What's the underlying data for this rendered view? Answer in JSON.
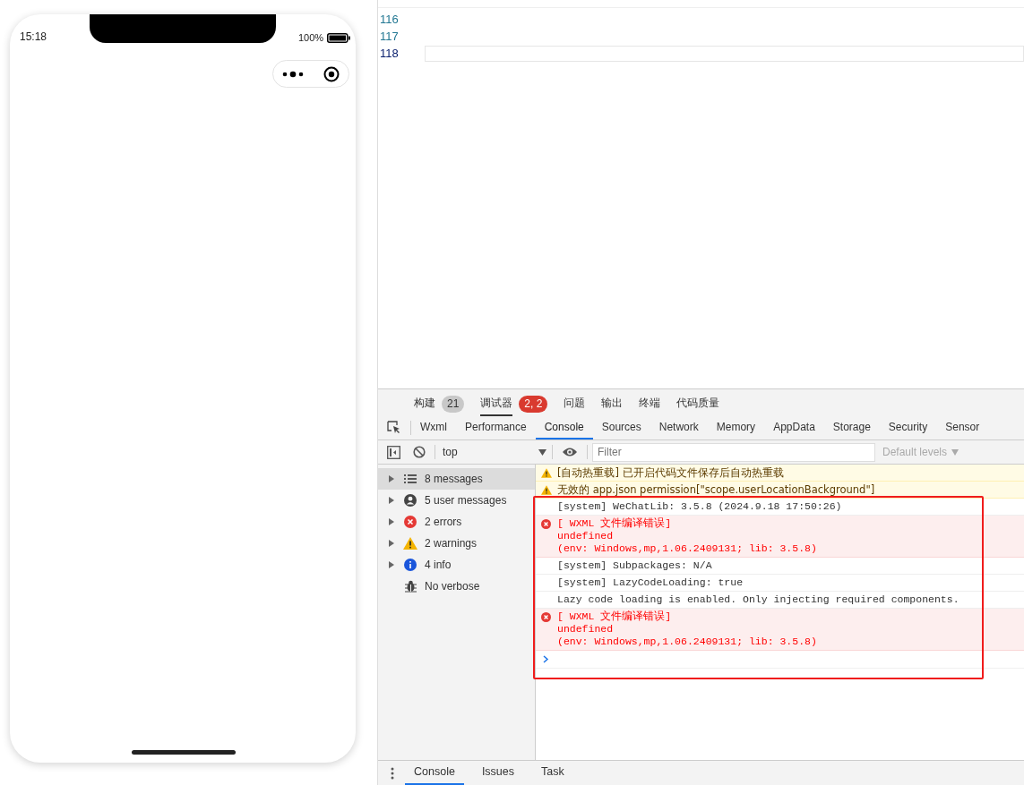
{
  "phone": {
    "time": "15:18",
    "battery": "100%"
  },
  "editor": {
    "lines": [
      {
        "number": "116",
        "current": false
      },
      {
        "number": "117",
        "current": false
      },
      {
        "number": "118",
        "current": true
      }
    ]
  },
  "panel_tabs": [
    {
      "label": "构建",
      "badge": "21",
      "alert": false,
      "selected": false
    },
    {
      "label": "调试器",
      "badge": "2, 2",
      "alert": true,
      "selected": true
    },
    {
      "label": "问题",
      "selected": false
    },
    {
      "label": "输出",
      "selected": false
    },
    {
      "label": "终端",
      "selected": false
    },
    {
      "label": "代码质量",
      "selected": false
    }
  ],
  "devtools_tabs": [
    {
      "label": "Wxml",
      "selected": false
    },
    {
      "label": "Performance",
      "selected": false
    },
    {
      "label": "Console",
      "selected": true
    },
    {
      "label": "Sources",
      "selected": false
    },
    {
      "label": "Network",
      "selected": false
    },
    {
      "label": "Memory",
      "selected": false
    },
    {
      "label": "AppData",
      "selected": false
    },
    {
      "label": "Storage",
      "selected": false
    },
    {
      "label": "Security",
      "selected": false
    },
    {
      "label": "Sensor",
      "selected": false
    }
  ],
  "toolbar": {
    "context": "top",
    "filter_placeholder": "Filter",
    "levels": "Default levels"
  },
  "sidebar": [
    {
      "label": "8 messages",
      "kind": "messages",
      "selected": true,
      "expandable": true
    },
    {
      "label": "5 user messages",
      "kind": "user",
      "selected": false,
      "expandable": true
    },
    {
      "label": "2 errors",
      "kind": "error",
      "selected": false,
      "expandable": true
    },
    {
      "label": "2 warnings",
      "kind": "warning",
      "selected": false,
      "expandable": true
    },
    {
      "label": "4 info",
      "kind": "info",
      "selected": false,
      "expandable": true
    },
    {
      "label": "No verbose",
      "kind": "verbose",
      "selected": false,
      "expandable": false
    }
  ],
  "messages": [
    {
      "kind": "warning",
      "lines": [
        "[自动热重载] 已开启代码文件保存后自动热重载"
      ]
    },
    {
      "kind": "warning",
      "lines": [
        "无效的 app.json permission[\"scope.userLocationBackground\"]"
      ]
    },
    {
      "kind": "log",
      "lines": [
        "[system] WeChatLib: 3.5.8 (2024.9.18 17:50:26)"
      ]
    },
    {
      "kind": "error",
      "lines": [
        "[ WXML 文件编译错误]",
        "undefined",
        "(env: Windows,mp,1.06.2409131; lib: 3.5.8)"
      ]
    },
    {
      "kind": "log",
      "lines": [
        "[system] Subpackages: N/A"
      ]
    },
    {
      "kind": "log",
      "lines": [
        "[system] LazyCodeLoading: true"
      ]
    },
    {
      "kind": "log",
      "lines": [
        "Lazy code loading is enabled. Only injecting required components."
      ]
    },
    {
      "kind": "error",
      "lines": [
        "[ WXML 文件编译错误]",
        "undefined",
        "(env: Windows,mp,1.06.2409131; lib: 3.5.8)"
      ]
    }
  ],
  "drawer_tabs": [
    {
      "label": "Console",
      "selected": true
    },
    {
      "label": "Issues",
      "selected": false
    },
    {
      "label": "Task",
      "selected": false
    }
  ]
}
